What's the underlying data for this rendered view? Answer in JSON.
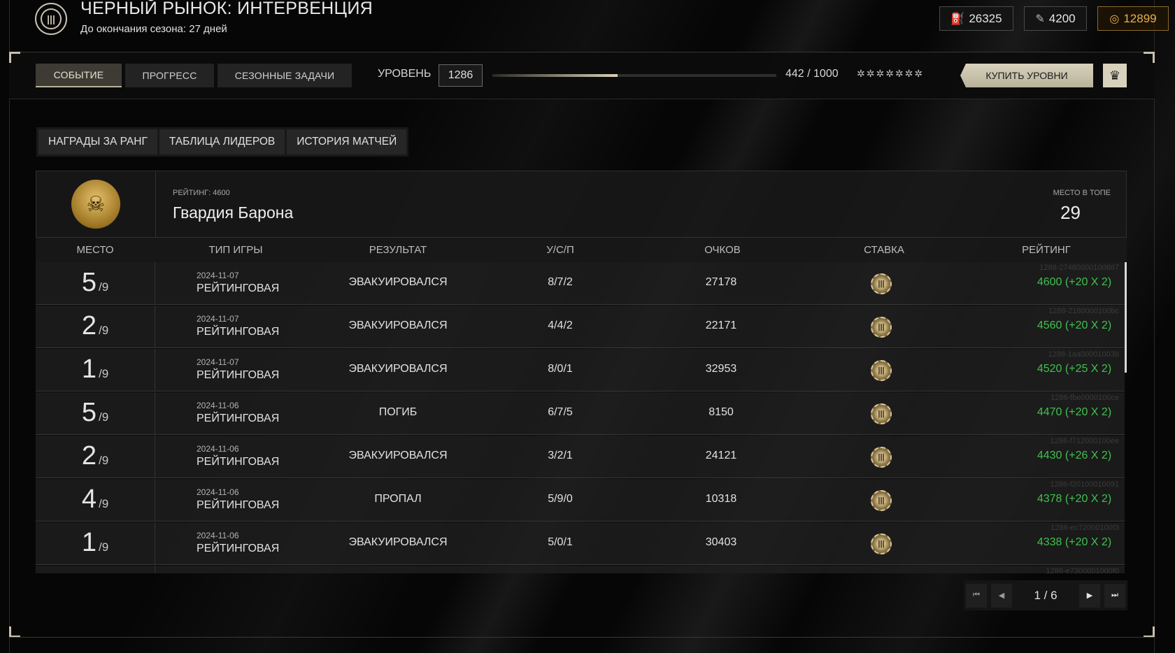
{
  "header": {
    "title": "ЧЕРНЫЙ РЫНОК: ИНТЕРВЕНЦИЯ",
    "subtitle_prefix": "До окончания сезона:",
    "subtitle_value": "27 дней",
    "logo_icon": "shotgun-shells-icon",
    "currencies": [
      {
        "icon": "fuel-icon",
        "value": "26325"
      },
      {
        "icon": "ticket-icon",
        "value": "4200"
      },
      {
        "icon": "coin-icon",
        "value": "12899",
        "color": "#e5b04c"
      }
    ]
  },
  "topbar": {
    "tabs": [
      {
        "label": "СОБЫТИЕ",
        "active": true
      },
      {
        "label": "ПРОГРЕСС",
        "active": false
      },
      {
        "label": "СЕЗОННЫЕ ЗАДАЧИ",
        "active": false
      }
    ],
    "level_label": "УРОВЕНЬ",
    "level_value": "1286",
    "xp_text": "442 / 1000",
    "xp_fraction": 0.442,
    "stars": "✲✲✲✲✲✲✲",
    "buy_label": "КУПИТЬ УРОВНИ",
    "crown_icon": "crown-icon"
  },
  "subtabs": [
    "НАГРАДЫ ЗА РАНГ",
    "ТАБЛИЦА ЛИДЕРОВ",
    "ИСТОРИЯ МАТЧЕЙ"
  ],
  "profile": {
    "rating_label": "РЕЙТИНГ: 4600",
    "team_name": "Гвардия Барона",
    "place_label": "МЕСТО В ТОПЕ",
    "place_value": "29"
  },
  "table": {
    "headers": [
      "МЕСТО",
      "ТИП ИГРЫ",
      "РЕЗУЛЬТАТ",
      "У/С/П",
      "ОЧКОВ",
      "СТАВКА",
      "РЕЙТИНГ"
    ],
    "rows": [
      {
        "place": "5",
        "of": "/9",
        "date": "2024-11-07",
        "type": "РЕЙТИНГОВАЯ",
        "result": "ЭВАКУИРОВАЛСЯ",
        "ksa": "8/7/2",
        "score": "27178",
        "rating": "4600 (+20 X 2)",
        "match_id": "1288-27480000100667"
      },
      {
        "place": "2",
        "of": "/9",
        "date": "2024-11-07",
        "type": "РЕЙТИНГОВАЯ",
        "result": "ЭВАКУИРОВАЛСЯ",
        "ksa": "4/4/2",
        "score": "22171",
        "rating": "4560 (+20 X 2)",
        "match_id": "1288-2180000100bc"
      },
      {
        "place": "1",
        "of": "/9",
        "date": "2024-11-07",
        "type": "РЕЙТИНГОВАЯ",
        "result": "ЭВАКУИРОВАЛСЯ",
        "ksa": "8/0/1",
        "score": "32953",
        "rating": "4520 (+25 X 2)",
        "match_id": "1288-1aa00001003b"
      },
      {
        "place": "5",
        "of": "/9",
        "date": "2024-11-06",
        "type": "РЕЙТИНГОВАЯ",
        "result": "ПОГИБ",
        "ksa": "6/7/5",
        "score": "8150",
        "rating": "4470 (+20 X 2)",
        "match_id": "1286-fbe0000100ce"
      },
      {
        "place": "2",
        "of": "/9",
        "date": "2024-11-06",
        "type": "РЕЙТИНГОВАЯ",
        "result": "ЭВАКУИРОВАЛСЯ",
        "ksa": "3/2/1",
        "score": "24121",
        "rating": "4430 (+26 X 2)",
        "match_id": "1286-f712000100ee"
      },
      {
        "place": "4",
        "of": "/9",
        "date": "2024-11-06",
        "type": "РЕЙТИНГОВАЯ",
        "result": "ПРОПАЛ",
        "ksa": "5/9/0",
        "score": "10318",
        "rating": "4378 (+20 X 2)",
        "match_id": "1286-f20100010091"
      },
      {
        "place": "1",
        "of": "/9",
        "date": "2024-11-06",
        "type": "РЕЙТИНГОВАЯ",
        "result": "ЭВАКУИРОВАЛСЯ",
        "ksa": "5/0/1",
        "score": "30403",
        "rating": "4338 (+20 X 2)",
        "match_id": "1286-ec72000100f3"
      },
      {
        "place": "",
        "of": "",
        "date": "",
        "type": "",
        "result": "",
        "ksa": "",
        "score": "",
        "rating": "",
        "match_id": "1286-e7300001000f0"
      }
    ],
    "stake_icon": "chip-icon",
    "rating_color": "#3fc14e"
  },
  "pagination": {
    "text": "1 / 6",
    "first_icon": "first-page-icon",
    "prev_icon": "prev-page-icon",
    "next_icon": "next-page-icon",
    "last_icon": "last-page-icon"
  }
}
